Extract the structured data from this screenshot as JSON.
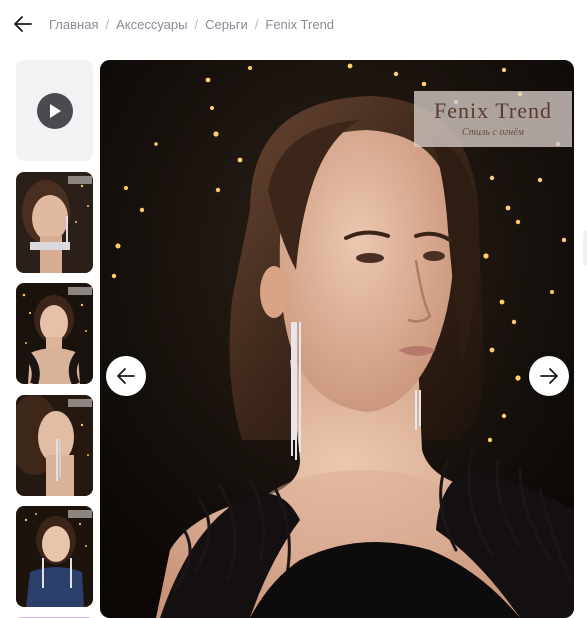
{
  "breadcrumb": {
    "items": [
      "Главная",
      "Аксессуары",
      "Серьги",
      "Fenix Trend"
    ],
    "separator": "/"
  },
  "icons": {
    "back": "arrow-left-icon",
    "play": "play-icon",
    "prev": "arrow-left-icon",
    "next": "arrow-right-icon"
  },
  "watermark": {
    "brand": "Fenix Trend",
    "slogan": "Стиль с огнём"
  },
  "gallery": {
    "thumbnail_count": 5,
    "selected_index": 0
  },
  "colors": {
    "breadcrumb_text": "#8b8b98",
    "thumb_bg": "#f2f2f5",
    "play_button": "#4a4a4f",
    "photo_bg": "#0d0a08"
  }
}
